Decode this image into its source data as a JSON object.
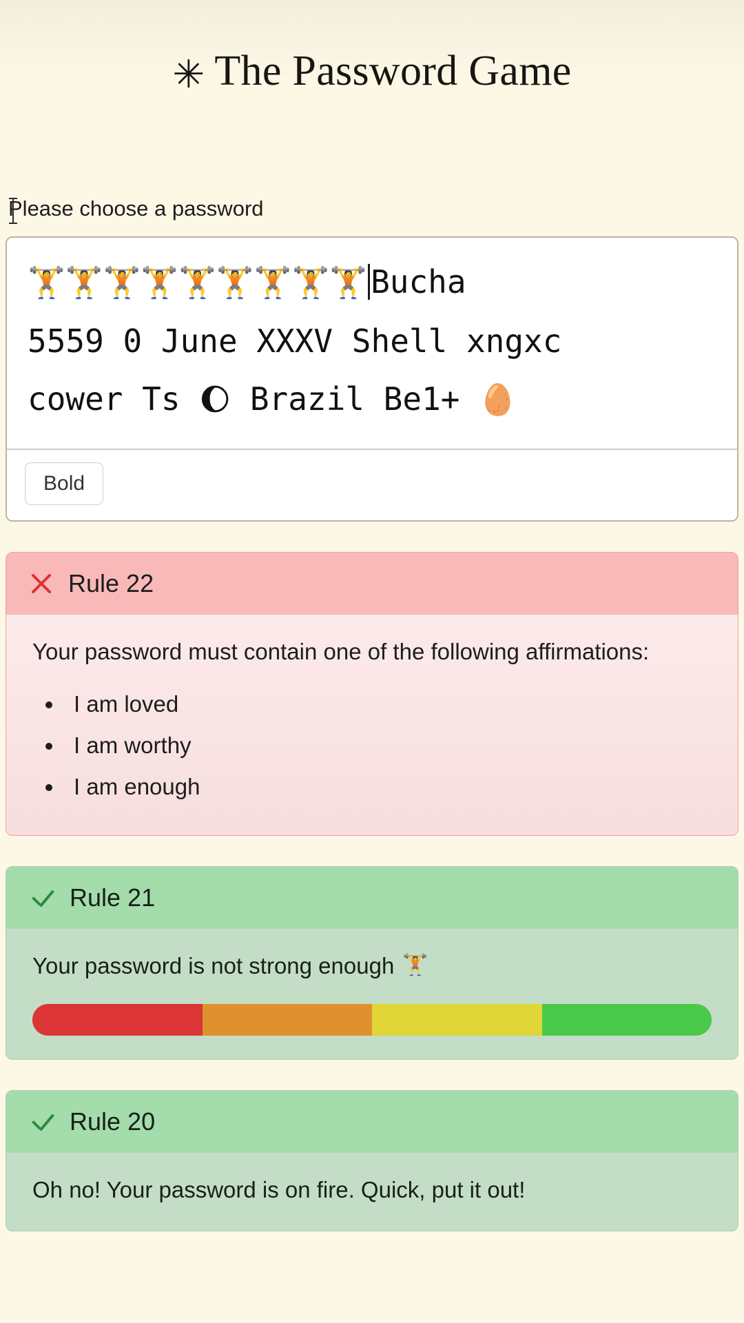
{
  "header": {
    "star_glyph": "✳",
    "title": "The Password Game"
  },
  "prompt": {
    "label": "Please choose a password",
    "cursor_icon": "text-cursor"
  },
  "password_editor": {
    "lines": [
      "🏋️🏋️🏋️🏋️🏋️🏋️🏋️🏋️🏋️",
      "Bucha",
      "5559 0 June XXXV Shell xngxc",
      "cower Ts 🌔 Brazil Be1+ 🥚"
    ],
    "line1_emoji_count": 9,
    "line1_emoji": "🏋️",
    "line1_text_after_caret": "Bucha",
    "line2": "5559 0 June XXXV Shell xngxc",
    "line3_before_moon": "cower Ts ",
    "line3_moon": "🌔",
    "line3_after_moon": " Brazil Be1+ ",
    "line3_egg": "🥚",
    "caret_visible": true
  },
  "toolbar": {
    "bold_label": "Bold"
  },
  "rules": [
    {
      "id": "rule-22",
      "status": "fail",
      "status_icon": "x-icon",
      "title": "Rule 22",
      "body": "Your password must contain one of the following affirmations:",
      "items": [
        "I am loved",
        "I am worthy",
        "I am enough"
      ]
    },
    {
      "id": "rule-21",
      "status": "pass",
      "status_icon": "check-icon",
      "title": "Rule 21",
      "body": "Your password is not strong enough ",
      "body_emoji": "🏋️",
      "strength_bar": {
        "segments": [
          {
            "name": "weak",
            "color": "#dc3535"
          },
          {
            "name": "fair",
            "color": "#e0912f"
          },
          {
            "name": "good",
            "color": "#e0d637"
          },
          {
            "name": "strong",
            "color": "#4ac94a"
          }
        ]
      }
    },
    {
      "id": "rule-20",
      "status": "pass",
      "status_icon": "check-icon",
      "title": "Rule 20",
      "body": "Oh no! Your password is on fire. Quick, put it out!"
    }
  ],
  "colors": {
    "page_background": "#fdf8e6",
    "fail_header": "#f9b9b9",
    "fail_body": "#fceaea",
    "pass_header": "#a4dcac",
    "pass_body": "#c4ddc6",
    "x_icon": "#e03131",
    "check_icon": "#2f8a3d"
  }
}
